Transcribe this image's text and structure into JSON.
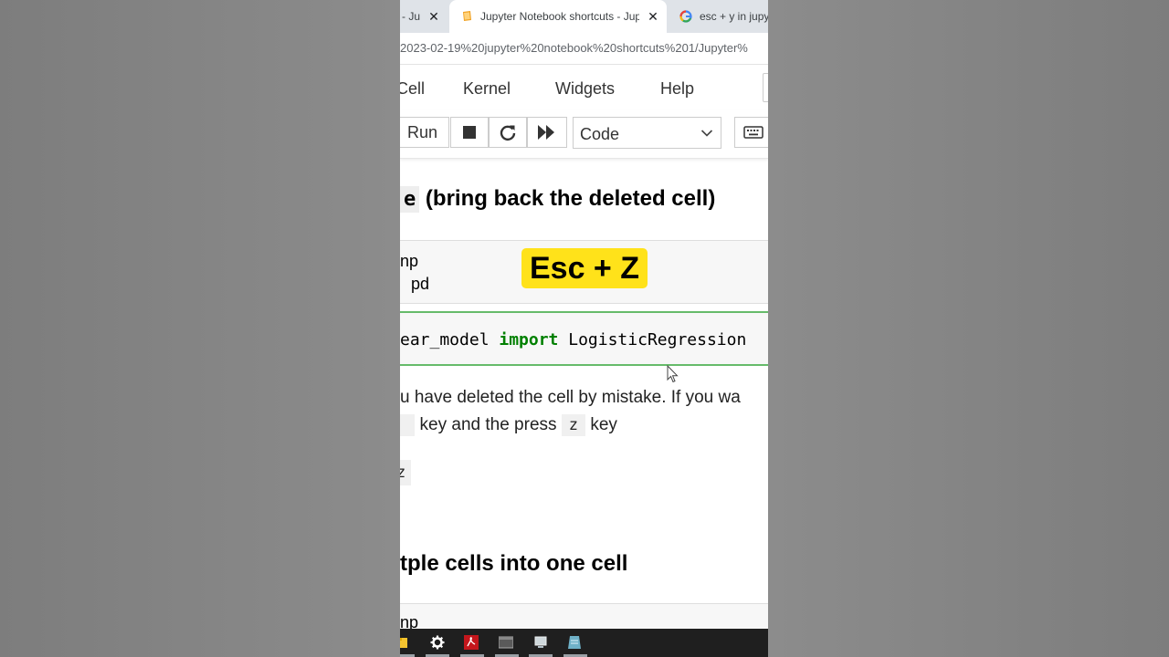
{
  "browser": {
    "tabs": [
      {
        "title": "- Jup",
        "close": "✕",
        "state": "inactive"
      },
      {
        "title": "Jupyter Notebook shortcuts - Jup",
        "close": "✕",
        "state": "active"
      },
      {
        "title": "esc + y in jupy",
        "state": "inactive"
      }
    ],
    "url": "2023-02-19%20jupyter%20notebook%20shortcuts%201/Jupyter%"
  },
  "menubar": {
    "items": [
      "Cell",
      "Kernel",
      "Widgets",
      "Help"
    ]
  },
  "toolbar": {
    "run_label": "Run",
    "cell_type_selected": "Code"
  },
  "notebook": {
    "heading1_code": "e",
    "heading1_text": " (bring back the deleted cell)",
    "cell1_lines": [
      "np",
      "pd"
    ],
    "overlay_shortcut": "Esc + Z",
    "cell2": {
      "prefix": "ear_model ",
      "keyword": "import",
      "suffix": " LogisticRegression"
    },
    "paragraph": {
      "line1": "u have deleted the cell by mistake. If you wa",
      "line2_after_chip": " key and the press ",
      "line2_code": "z",
      "line2_end": " key"
    },
    "lone_chip": "z",
    "heading2": "tple cells into one cell",
    "cell3_line": "np"
  },
  "colors": {
    "overlay_bg": "#ffe21a",
    "keyword": "#008000",
    "selected_cell_border": "#66bb6a"
  }
}
